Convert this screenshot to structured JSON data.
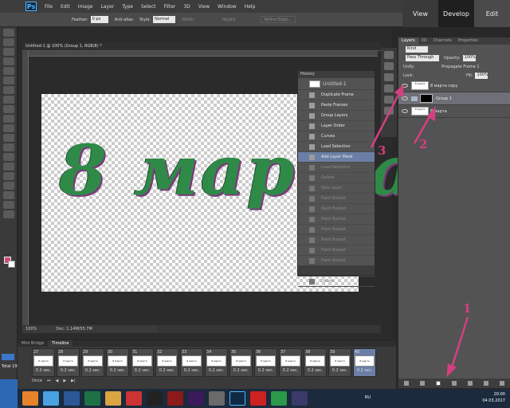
{
  "menubar": {
    "logo": "Ps",
    "items": [
      "File",
      "Edit",
      "Image",
      "Layer",
      "Type",
      "Select",
      "Filter",
      "3D",
      "View",
      "Window",
      "Help"
    ]
  },
  "workspace": {
    "view": "View",
    "develop": "Develop",
    "edit": "Edit"
  },
  "options_bar": {
    "feather_label": "Feather:",
    "feather_value": "0 px",
    "antialias_label": "Anti-alias",
    "style_label": "Style:",
    "style_value": "Normal",
    "width_label": "Width:",
    "height_label": "Height:",
    "refine_edge": "Refine Edge..."
  },
  "document": {
    "tab_title": "Untitled-1 @ 100% (Group 1, RGB/8) *",
    "canvas_text": "8 марта",
    "zoom": "100%",
    "doc_size": "Doc: 1.14M/55.7M"
  },
  "history": {
    "title": "History",
    "snapshot": "Untitled-1",
    "items": [
      {
        "label": "Duplicate Frame",
        "state": "normal"
      },
      {
        "label": "Paste Frames",
        "state": "normal"
      },
      {
        "label": "Group Layers",
        "state": "normal"
      },
      {
        "label": "Layer Order",
        "state": "normal"
      },
      {
        "label": "Curves",
        "state": "normal"
      },
      {
        "label": "Load Selection",
        "state": "normal"
      },
      {
        "label": "Add Layer Mask",
        "state": "active"
      },
      {
        "label": "Load Selection",
        "state": "dim"
      },
      {
        "label": "Delete",
        "state": "dim"
      },
      {
        "label": "New Layer",
        "state": "dim"
      },
      {
        "label": "Paint Bucket",
        "state": "dim"
      },
      {
        "label": "Paint Bucket",
        "state": "dim"
      },
      {
        "label": "Paint Bucket",
        "state": "dim"
      },
      {
        "label": "Paint Bucket",
        "state": "dim"
      },
      {
        "label": "Paint Bucket",
        "state": "dim"
      },
      {
        "label": "Paint Bucket",
        "state": "dim"
      },
      {
        "label": "Paint Bucket",
        "state": "dim"
      },
      {
        "label": "Paint Bucket",
        "state": "dim"
      },
      {
        "label": "Delete",
        "state": "dim"
      }
    ]
  },
  "layers": {
    "tabs": [
      "Layers",
      "3D",
      "Channels",
      "Properties"
    ],
    "kind": "Kind",
    "blend_mode": "Pass Through",
    "opacity_label": "Opacity:",
    "opacity_value": "100%",
    "unify_label": "Unify:",
    "propagate": "Propagate Frame 1",
    "lock_label": "Lock:",
    "fill_label": "Fill:",
    "fill_value": "100%",
    "rows": [
      {
        "name": "8 марта copy",
        "type": "layer",
        "selected": false
      },
      {
        "name": "Group 1",
        "type": "group",
        "selected": true
      },
      {
        "name": "8 марта",
        "type": "layer",
        "selected": false
      }
    ],
    "thumb_text": "8 марта"
  },
  "timeline": {
    "tabs": [
      "Mini Bridge",
      "Timeline"
    ],
    "frames": [
      {
        "num": "27",
        "delay": "0.2 sec."
      },
      {
        "num": "28",
        "delay": "0.2 sec."
      },
      {
        "num": "29",
        "delay": "0.2 sec."
      },
      {
        "num": "30",
        "delay": "0.2 sec."
      },
      {
        "num": "31",
        "delay": "0.2 sec."
      },
      {
        "num": "32",
        "delay": "0.2 sec."
      },
      {
        "num": "33",
        "delay": "0.2 sec."
      },
      {
        "num": "34",
        "delay": "0.2 sec."
      },
      {
        "num": "35",
        "delay": "0.2 sec."
      },
      {
        "num": "36",
        "delay": "0.2 sec."
      },
      {
        "num": "37",
        "delay": "0.2 sec."
      },
      {
        "num": "38",
        "delay": "0.2 sec."
      },
      {
        "num": "39",
        "delay": "0.2 sec."
      },
      {
        "num": "40",
        "delay": "0.2 sec."
      }
    ],
    "loop": "Once",
    "frame_thumb": "8 марта"
  },
  "annotations": [
    "1",
    "2",
    "3"
  ],
  "sidebar": {
    "total": "Total 19"
  },
  "taskbar": {
    "lang": "RU",
    "time": "20:00",
    "date": "04.03.2017"
  },
  "colors": {
    "annotation": "#d4407f",
    "accent": "#6b7fa6",
    "foreground": "#d24a7a"
  }
}
